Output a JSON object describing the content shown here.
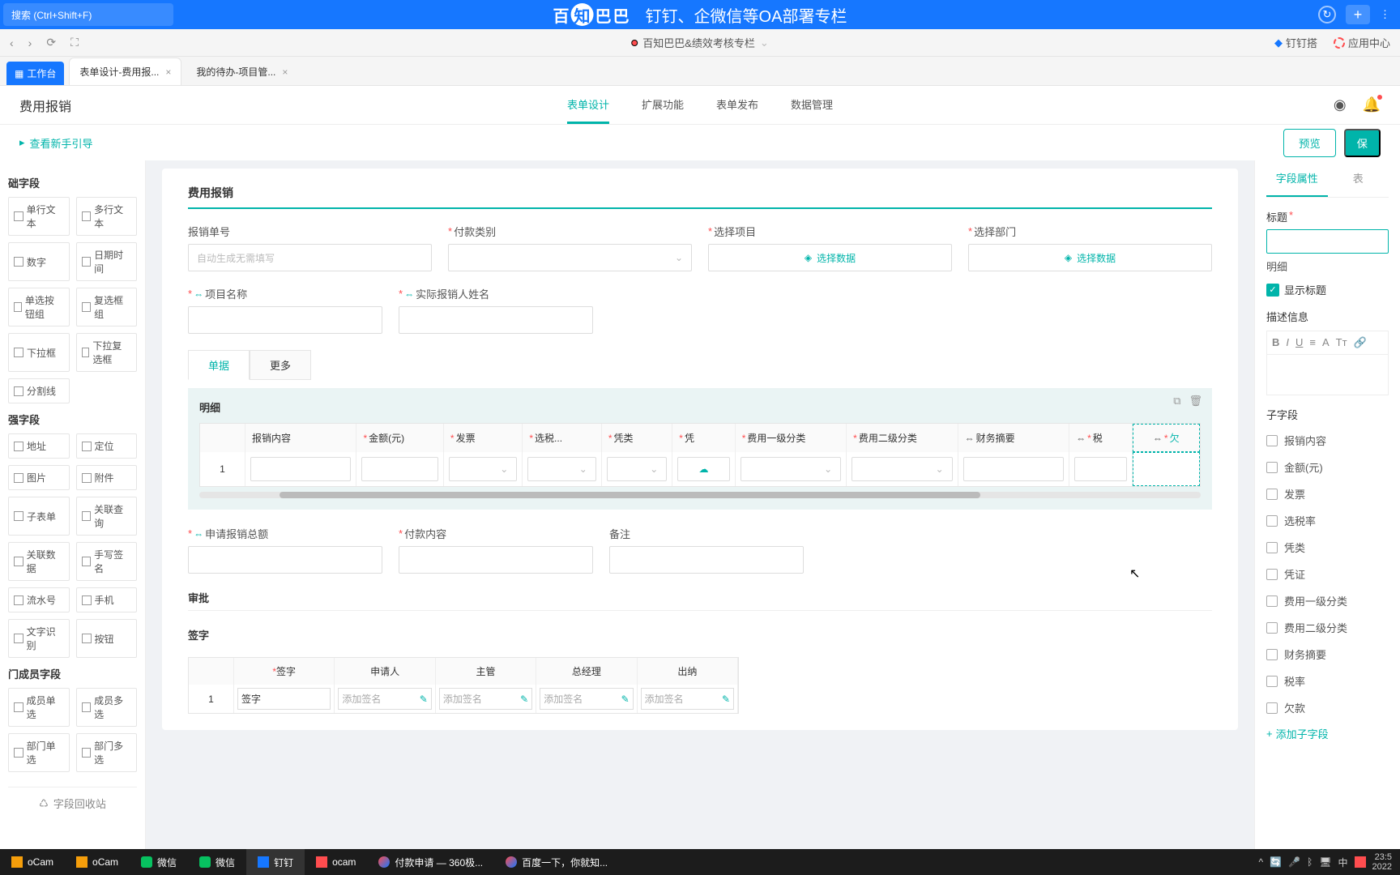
{
  "topbar": {
    "search_placeholder": "搜索 (Ctrl+Shift+F)",
    "banner_logo": {
      "b1": "百",
      "b2": "知",
      "b3": "巴",
      "b4": "巴"
    },
    "banner_text": "钉钉、企微信等OA部署专栏"
  },
  "navbar": {
    "workspace": "百知巴巴&绩效考核专栏",
    "dingding": "钉钉搭",
    "appcenter": "应用中心"
  },
  "tabs": {
    "workbench": "工作台",
    "tab1": "表单设计-费用报...",
    "tab2": "我的待办-项目管..."
  },
  "header": {
    "title": "费用报销",
    "nav": [
      "表单设计",
      "扩展功能",
      "表单发布",
      "数据管理"
    ]
  },
  "subheader": {
    "guide": "查看新手引导",
    "preview": "预览",
    "save": "保"
  },
  "palette": {
    "sections": [
      {
        "title": "础字段",
        "items": [
          "单行文本",
          "多行文本",
          "数字",
          "日期时间",
          "单选按钮组",
          "复选框组",
          "下拉框",
          "下拉复选框",
          "分割线"
        ]
      },
      {
        "title": "强字段",
        "items": [
          "地址",
          "定位",
          "图片",
          "附件",
          "子表单",
          "关联查询",
          "关联数据",
          "手写签名",
          "流水号",
          "手机",
          "文字识别",
          "按钮"
        ]
      },
      {
        "title": "门成员字段",
        "items": [
          "成员单选",
          "成员多选",
          "部门单选",
          "部门多选"
        ]
      }
    ],
    "recycle": "字段回收站"
  },
  "form": {
    "section_title": "费用报销",
    "fields": {
      "order_no": {
        "label": "报销单号",
        "placeholder": "自动生成无需填写"
      },
      "pay_type": {
        "label": "付款类别"
      },
      "project_sel": {
        "label": "选择项目",
        "btn": "选择数据"
      },
      "dept_sel": {
        "label": "选择部门",
        "btn": "选择数据"
      },
      "project_name": {
        "label": "项目名称"
      },
      "real_person": {
        "label": "实际报销人姓名"
      },
      "total": {
        "label": "申请报销总额"
      },
      "pay_content": {
        "label": "付款内容"
      },
      "remark": {
        "label": "备注"
      }
    },
    "detail_tabs": [
      "单据",
      "更多"
    ],
    "detail_title": "明细",
    "detail_cols": [
      "报销内容",
      "金额(元)",
      "发票",
      "选税...",
      "凭类",
      "凭",
      "费用一级分类",
      "费用二级分类",
      "财务摘要",
      "税",
      "欠"
    ],
    "approve_title": "审批",
    "sign_title": "签字",
    "sign_cols": [
      "签字",
      "申请人",
      "主管",
      "总经理",
      "出纳"
    ],
    "sign_label": "签字",
    "add_sign": "添加签名"
  },
  "props": {
    "tabs": [
      "字段属性",
      "表"
    ],
    "title_label": "标题",
    "title_value": "明细",
    "show_title": "显示标题",
    "desc_label": "描述信息",
    "subfield_label": "子字段",
    "subfields": [
      "报销内容",
      "金额(元)",
      "发票",
      "选税率",
      "凭类",
      "凭证",
      "费用一级分类",
      "费用二级分类",
      "财务摘要",
      "税率",
      "欠款"
    ],
    "add_sub": "添加子字段"
  },
  "taskbar": {
    "items": [
      "oCam",
      "oCam",
      "微信",
      "微信",
      "钉钉",
      "ocam",
      "付款申请 — 360极...",
      "百度一下，你就知..."
    ],
    "time": "23:5",
    "date": "2022"
  }
}
